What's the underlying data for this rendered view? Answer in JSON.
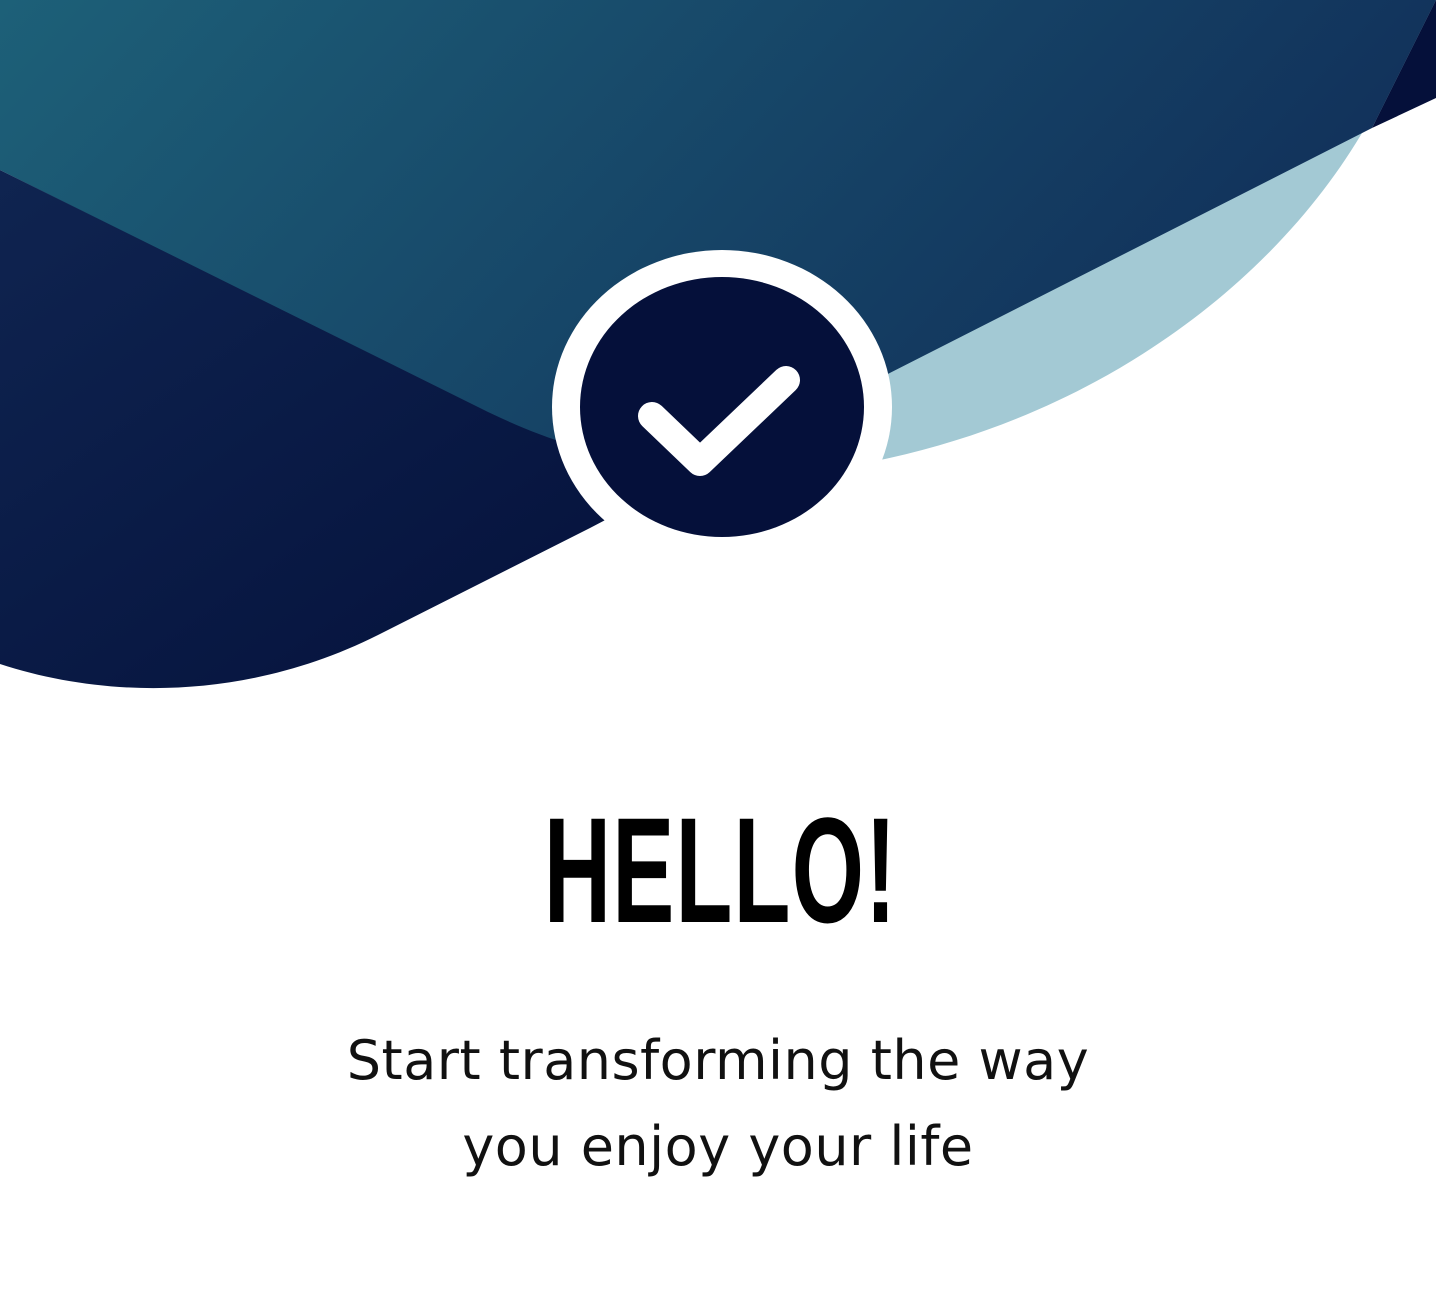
{
  "colors": {
    "background": "#ffffff",
    "wave_light_start": "#1d6078",
    "wave_light_end": "#11305a",
    "wave_dark_start": "#0f2450",
    "wave_dark_end": "#04103a",
    "wave_pale": "#a3c9d4",
    "badge_fill": "#05103a",
    "badge_ring": "#ffffff",
    "checkmark": "#ffffff",
    "headline": "#000000",
    "subtitle": "#111111"
  },
  "icons": {
    "badge": "check-circle-icon"
  },
  "welcome": {
    "headline": "HELLO!",
    "subtitle_line_1": "Start transforming the way",
    "subtitle_line_2": "you enjoy your life"
  }
}
